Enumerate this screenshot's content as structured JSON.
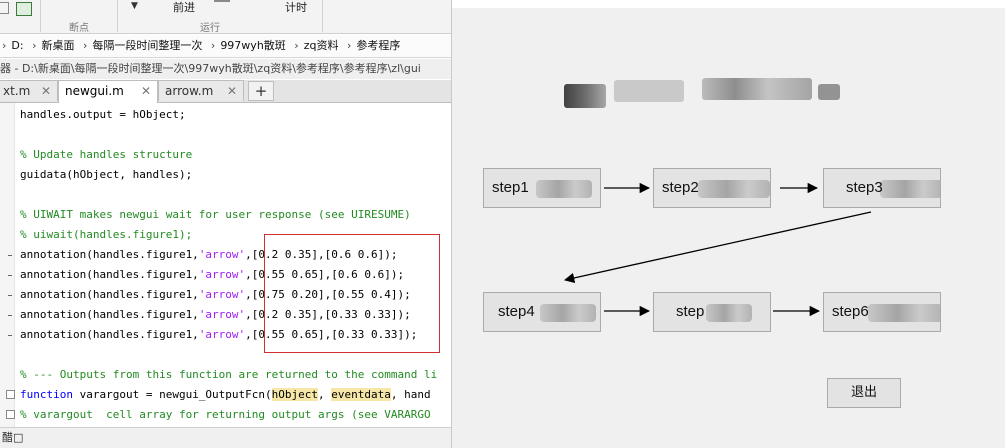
{
  "toolstrip": {
    "forward_label": "前进",
    "timer_label": "计时",
    "group_breakpoints": "断点",
    "group_run": "运行"
  },
  "path": {
    "crumbs": [
      "D:",
      "新桌面",
      "每隔一段时间整理一次",
      "997wyh散斑",
      "zq资料",
      "参考程序"
    ]
  },
  "editor_title": "器 - D:\\新桌面\\每隔一段时间整理一次\\997wyh散斑\\zq资料\\参考程序\\参考程序\\zl\\gui",
  "tabs": [
    {
      "label": "xt.m"
    },
    {
      "label": "newgui.m"
    },
    {
      "label": "arrow.m"
    }
  ],
  "tab_add_label": "+",
  "code": {
    "l1": "handles.output = hObject;",
    "l2": "% Update handles structure",
    "l3": "guidata(hObject, handles);",
    "l4": "% UIWAIT makes newgui wait for user response (see UIRESUME)",
    "l5": "% uiwait(handles.figure1);",
    "a_prefix": "annotation(handles.figure1,",
    "a_str": "'arrow'",
    "a1": ",[0.2 0.35],[0.6 0.6]);",
    "a2": ",[0.55 0.65],[0.6 0.6]);",
    "a3": ",[0.75 0.20],[0.55 0.4]);",
    "a4": ",[0.2 0.35],[0.33 0.33]);",
    "a5": ",[0.55 0.65],[0.33 0.33]);",
    "l6": "% --- Outputs from this function are returned to the command li",
    "fn_kw": "function",
    "fn_a": " varargout = newgui_OutputFcn(",
    "fn_p1": "hObject",
    "fn_sep": ", ",
    "fn_p2": "eventdata",
    "fn_rest": ", hand",
    "l8": "% varargout  cell array for returning output args (see VARARGO"
  },
  "status": {
    "text": "醋□"
  },
  "figure": {
    "steps": [
      "step1",
      "step2",
      "step3",
      "step4",
      "step",
      "step6"
    ],
    "exit_label": "退出"
  },
  "colors": {
    "comment": "#228b22",
    "string": "#a020f0",
    "keyword": "#0000ff",
    "highlight_box": "#d03030"
  }
}
